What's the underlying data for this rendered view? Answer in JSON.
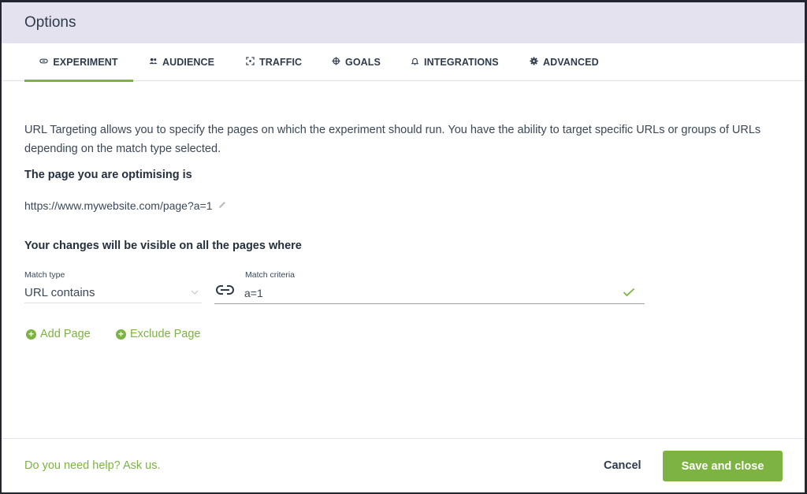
{
  "window": {
    "title": "Options"
  },
  "tabs": [
    {
      "label": "EXPERIMENT",
      "icon": "link-icon",
      "active": true
    },
    {
      "label": "AUDIENCE",
      "icon": "people-icon",
      "active": false
    },
    {
      "label": "TRAFFIC",
      "icon": "traffic-focus-icon",
      "active": false
    },
    {
      "label": "GOALS",
      "icon": "crosshair-icon",
      "active": false
    },
    {
      "label": "INTEGRATIONS",
      "icon": "bell-icon",
      "active": false
    },
    {
      "label": "ADVANCED",
      "icon": "gear-icon",
      "active": false
    }
  ],
  "content": {
    "description": "URL Targeting allows you to specify the pages on which the experiment should run. You have the ability to target specific URLs or groups of URLs depending on the match type selected.",
    "optimising_heading": "The page you are optimising is",
    "page_url": "https://www.mywebsite.com/page?a=1",
    "visibility_heading": "Your changes will be visible on all the pages where",
    "match_type": {
      "label": "Match type",
      "value": "URL contains"
    },
    "match_criteria": {
      "label": "Match criteria",
      "value": "a=1",
      "valid": true
    },
    "add_page_label": "Add Page",
    "exclude_page_label": "Exclude Page"
  },
  "footer": {
    "help_text": "Do you need help? Ask us.",
    "cancel_label": "Cancel",
    "save_label": "Save and close"
  },
  "colors": {
    "accent": "#7cb342",
    "header_bg": "#e4e2ee",
    "text": "#2e3b4c"
  }
}
